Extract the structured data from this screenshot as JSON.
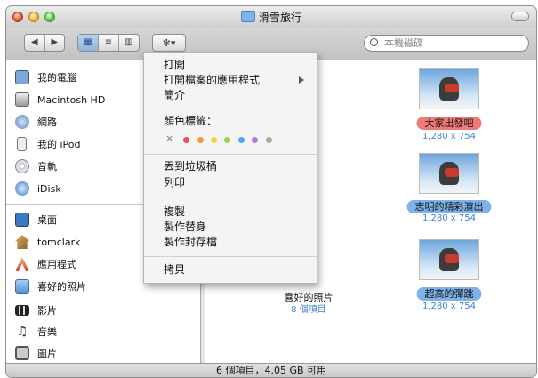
{
  "window": {
    "title": "滑雪旅行"
  },
  "toolbar": {
    "back_forward": [
      "◀",
      "▶"
    ],
    "view_icons": "▦",
    "view_list": "≡",
    "view_columns": "▥",
    "action_glyph": "✻▾",
    "search_placeholder": "本機磁碟"
  },
  "sidebar": {
    "devices": [
      {
        "label": "我的電腦",
        "icon": "computer-icon"
      },
      {
        "label": "Macintosh HD",
        "icon": "hard-drive-icon"
      },
      {
        "label": "網路",
        "icon": "network-icon"
      },
      {
        "label": "我的 iPod",
        "icon": "ipod-icon"
      },
      {
        "label": "音軌",
        "icon": "cd-icon"
      },
      {
        "label": "iDisk",
        "icon": "idisk-icon"
      }
    ],
    "places": [
      {
        "label": "桌面",
        "icon": "desktop-icon"
      },
      {
        "label": "tomclark",
        "icon": "home-icon"
      },
      {
        "label": "應用程式",
        "icon": "applications-icon"
      },
      {
        "label": "喜好的照片",
        "icon": "folder-icon"
      },
      {
        "label": "影片",
        "icon": "movies-icon"
      },
      {
        "label": "音樂",
        "icon": "music-icon"
      },
      {
        "label": "圖片",
        "icon": "pictures-icon"
      }
    ]
  },
  "menu": {
    "open": "打開",
    "open_with": "打開檔案的應用程式",
    "get_info": "簡介",
    "color_label": "顏色標籤：",
    "label_clear": "×",
    "label_colors": [
      "#e8505a",
      "#f39a3a",
      "#f2d23c",
      "#9ccf45",
      "#4aa9e8",
      "#b77ad6",
      "#a8a8a8"
    ],
    "trash": "丟到垃圾桶",
    "print": "列印",
    "copy": "複製",
    "alias": "製作替身",
    "archive": "製作封存檔",
    "copy2": "拷貝"
  },
  "files": [
    {
      "name": "大家出發吧",
      "dims": "1,280 x 754",
      "label_color": "#f07a78"
    },
    {
      "name": "志明的精彩演出",
      "dims": "1,280 x 754",
      "label_color": "#7fb2ea"
    },
    {
      "name": "超高的彈跳",
      "dims": "1,280 x 754",
      "label_color": "#7fb2ea"
    }
  ],
  "folder": {
    "name": "喜好的照片",
    "items": "8 個項目"
  },
  "status": {
    "text": "6 個項目，4.05 GB 可用"
  }
}
